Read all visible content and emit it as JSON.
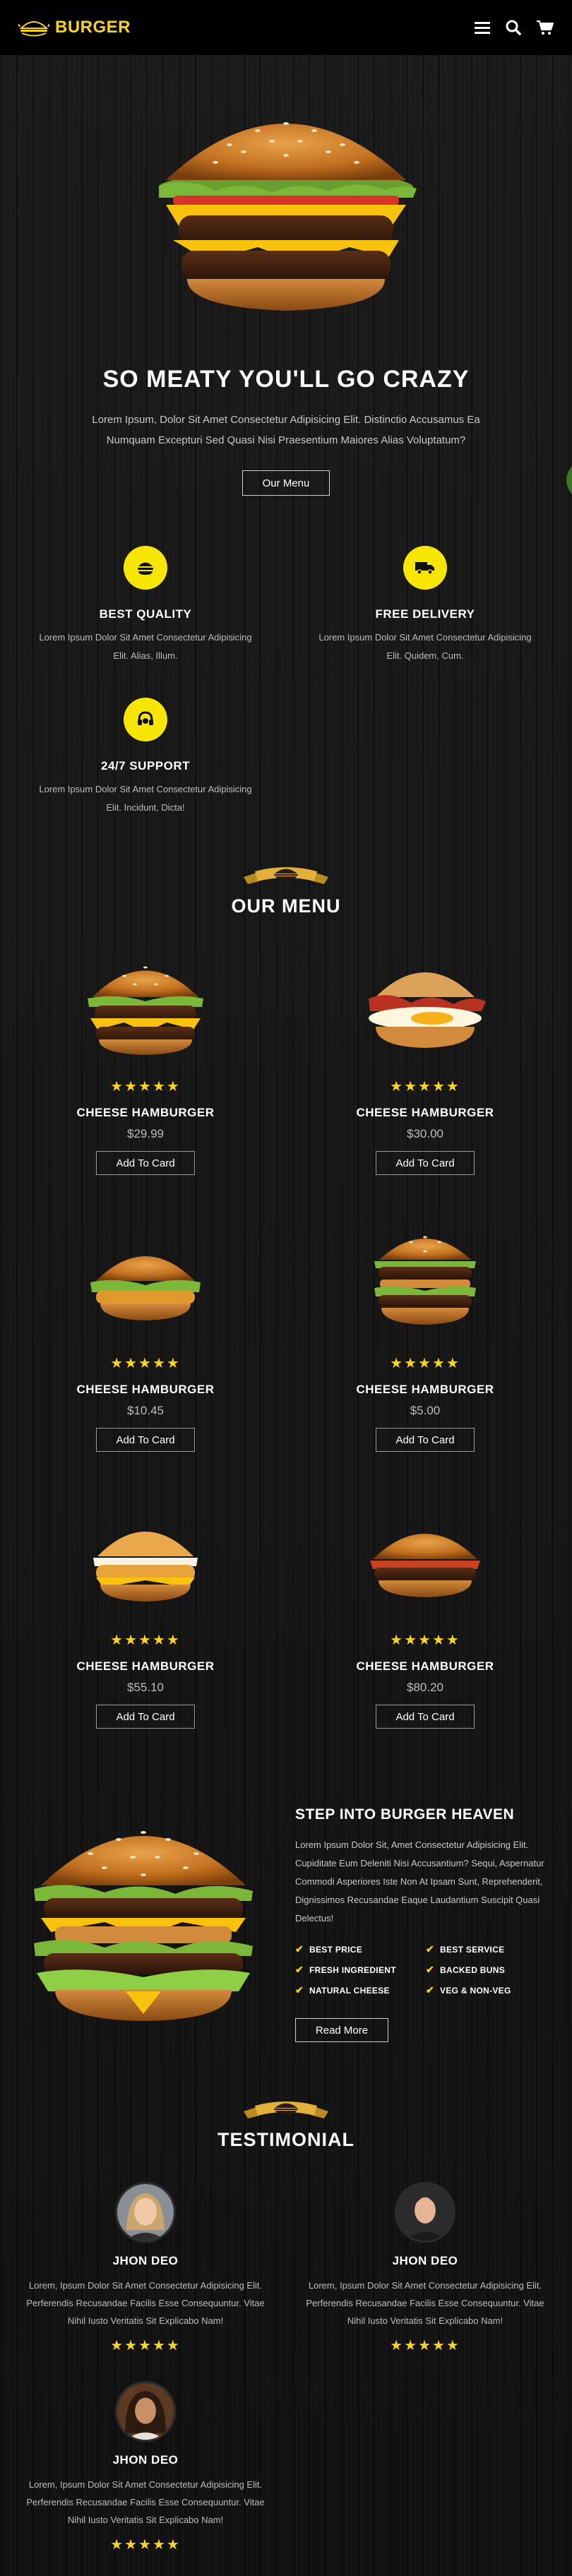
{
  "brand": {
    "name": "BURGER",
    "accent": "#f9d423"
  },
  "nav": {
    "icons": [
      "menu-icon",
      "search-icon",
      "cart-icon"
    ]
  },
  "hero": {
    "title": "SO MEATY YOU'LL GO CRAZY",
    "description": "Lorem Ipsum, Dolor Sit Amet Consectetur Adipisicing Elit. Distinctio Accusamus Ea Numquam Excepturi Sed Quasi Nisi Praesentium Maiores Alias Voluptatum?",
    "button": "Our Menu"
  },
  "features": [
    {
      "title": "BEST QUALITY",
      "description": "Lorem Ipsum Dolor Sit Amet Consectetur Adipisicing Elit. Alias, Illum.",
      "icon": "burger-icon"
    },
    {
      "title": "FREE DELIVERY",
      "description": "Lorem Ipsum Dolor Sit Amet Consectetur Adipisicing Elit. Quidem, Cum.",
      "icon": "truck-icon"
    },
    {
      "title": "24/7 SUPPORT",
      "description": "Lorem Ipsum Dolor Sit Amet Consectetur Adipisicing Elit. Incidunt, Dicta!",
      "icon": "headset-icon"
    }
  ],
  "menu": {
    "title": "OUR MENU",
    "items": [
      {
        "name": "CHEESE HAMBURGER",
        "price": "$29.99",
        "button": "Add To Card",
        "stars": "★★★★★"
      },
      {
        "name": "CHEESE HAMBURGER",
        "price": "$30.00",
        "button": "Add To Card",
        "stars": "★★★★★"
      },
      {
        "name": "CHEESE HAMBURGER",
        "price": "$10.45",
        "button": "Add To Card",
        "stars": "★★★★★"
      },
      {
        "name": "CHEESE HAMBURGER",
        "price": "$5.00",
        "button": "Add To Card",
        "stars": "★★★★★"
      },
      {
        "name": "CHEESE HAMBURGER",
        "price": "$55.10",
        "button": "Add To Card",
        "stars": "★★★★★"
      },
      {
        "name": "CHEESE HAMBURGER",
        "price": "$80.20",
        "button": "Add To Card",
        "stars": "★★★★★"
      }
    ]
  },
  "about": {
    "title": "STEP INTO BURGER HEAVEN",
    "description": "Lorem Ipsum Dolor Sit, Amet Consectetur Adipisicing Elit. Cupiditate Eum Deleniti Nisi Accusantium? Sequi, Aspernatur Commodi Asperiores Iste Non At Ipsam Sunt, Reprehenderit, Dignissimos Recusandae Eaque Laudantium Suscipit Quasi Delectus!",
    "checks": [
      "BEST PRICE",
      "BEST SERVICE",
      "FRESH INGREDIENT",
      "BACKED BUNS",
      "NATURAL CHEESE",
      "VEG & NON-VEG"
    ],
    "button": "Read More"
  },
  "testimonial": {
    "title": "TESTIMONIAL",
    "items": [
      {
        "name": "JHON DEO",
        "text": "Lorem, Ipsum Dolor Sit Amet Consectetur Adipisicing Elit. Perferendis Recusandae Facilis Esse Consequuntur. Vitae Nihil Iusto Veritatis Sit Explicabo Nam!",
        "stars": "★★★★★"
      },
      {
        "name": "JHON DEO",
        "text": "Lorem, Ipsum Dolor Sit Amet Consectetur Adipisicing Elit. Perferendis Recusandae Facilis Esse Consequuntur. Vitae Nihil Iusto Veritatis Sit Explicabo Nam!",
        "stars": "★★★★★"
      },
      {
        "name": "JHON DEO",
        "text": "Lorem, Ipsum Dolor Sit Amet Consectetur Adipisicing Elit. Perferendis Recusandae Facilis Esse Consequuntur. Vitae Nihil Iusto Veritatis Sit Explicabo Nam!",
        "stars": "★★★★★"
      }
    ]
  }
}
